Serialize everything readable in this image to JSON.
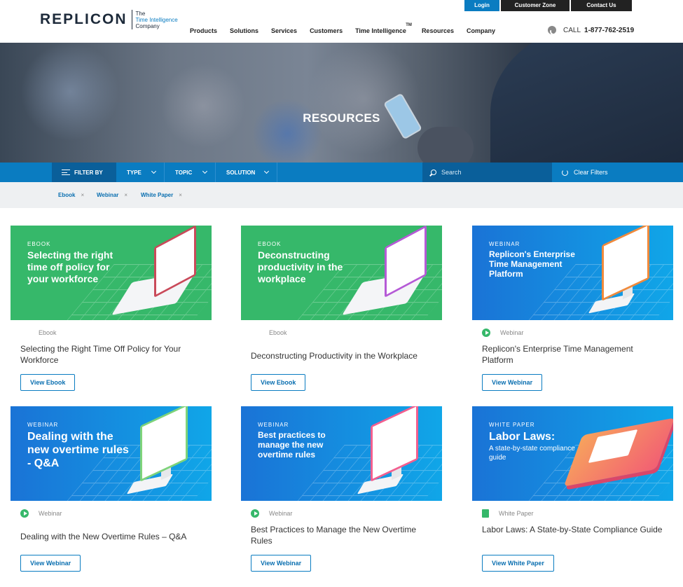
{
  "header": {
    "logo_word": "REPLICON",
    "logo_tag_1": "The",
    "logo_tag_2": "Time Intelligence",
    "logo_tag_3": "Company",
    "topbar": {
      "login": "Login",
      "customer_zone": "Customer Zone",
      "contact_us": "Contact Us"
    },
    "nav": [
      "Products",
      "Solutions",
      "Services",
      "Customers",
      "Time Intelligence",
      "Resources",
      "Company"
    ],
    "nav_tm": "TM",
    "call_label": "CALL",
    "phone": "1-877-762-2519"
  },
  "hero": {
    "title": "RESOURCES"
  },
  "filterbar": {
    "filter_by": "FILTER BY",
    "dropdowns": [
      "TYPE",
      "TOPIC",
      "SOLUTION"
    ],
    "search_placeholder": "Search",
    "clear": "Clear Filters"
  },
  "active_filters": [
    {
      "label": "Ebook",
      "remove": "×"
    },
    {
      "label": "Webinar",
      "remove": "×"
    },
    {
      "label": "White Paper",
      "remove": "×"
    }
  ],
  "cards": [
    {
      "kicker": "EBOOK",
      "image_title": "Selecting the right time off policy for your workforce",
      "type": "Ebook",
      "title": "Selecting the Right Time Off Policy for Your Workforce",
      "button": "View Ebook",
      "color": "#36b86a"
    },
    {
      "kicker": "EBOOK",
      "image_title": "Deconstructing productivity in the workplace",
      "type": "Ebook",
      "title": "Deconstructing Productivity in the Workplace",
      "button": "View Ebook",
      "color": "#36b86a"
    },
    {
      "kicker": "WEBINAR",
      "image_title": "Replicon's Enterprise Time Management Platform",
      "type": "Webinar",
      "title": "Replicon's Enterprise Time Management Platform",
      "button": "View Webinar",
      "color": "#1a73d6"
    },
    {
      "kicker": "WEBINAR",
      "image_title": "Dealing with the new overtime rules - Q&A",
      "type": "Webinar",
      "title": "Dealing with the New Overtime Rules – Q&A",
      "button": "View Webinar",
      "color": "#1a73d6"
    },
    {
      "kicker": "WEBINAR",
      "image_title": "Best practices to manage the new overtime rules",
      "type": "Webinar",
      "title": "Best Practices to Manage the New Overtime Rules",
      "button": "View Webinar",
      "color": "#1a73d6"
    },
    {
      "kicker": "WHITE PAPER",
      "image_title": "Labor Laws:",
      "image_subtitle": "A state-by-state compliance guide",
      "type": "White Paper",
      "title": "Labor Laws: A State-by-State Compliance Guide",
      "button": "View White Paper",
      "color": "#1a73d6"
    }
  ]
}
